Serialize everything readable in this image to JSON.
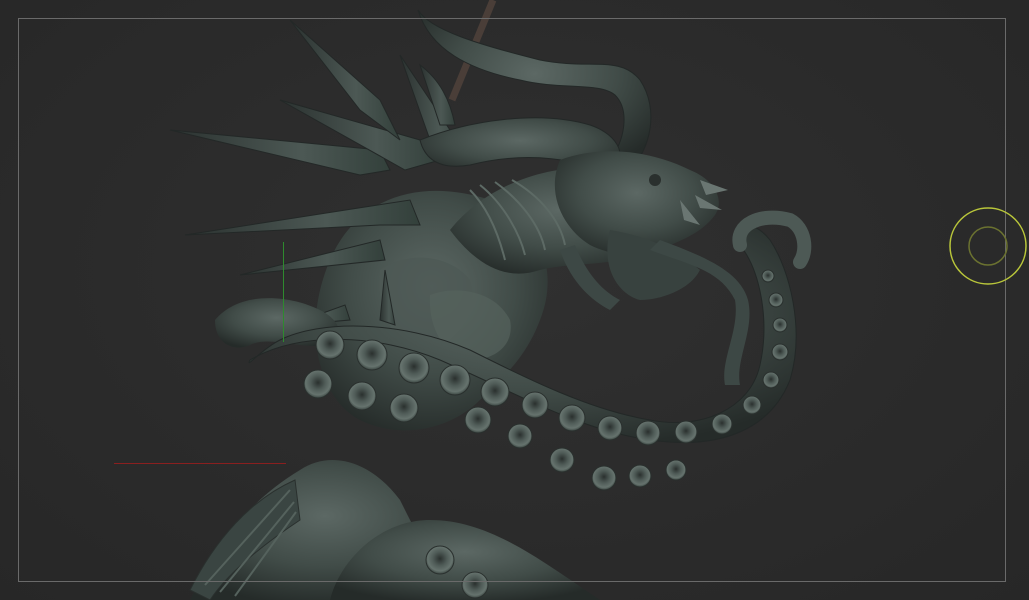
{
  "viewport": {
    "background_color": "#2a2a2a",
    "model_color": "#3f4a46",
    "frame_color": "#6a6a6a",
    "axis_colors": {
      "x": "#8a1f1f",
      "y": "#2e8a2e"
    },
    "gizmo_color": "#b9c63a",
    "subject": "sea-dragon-sculpt"
  }
}
